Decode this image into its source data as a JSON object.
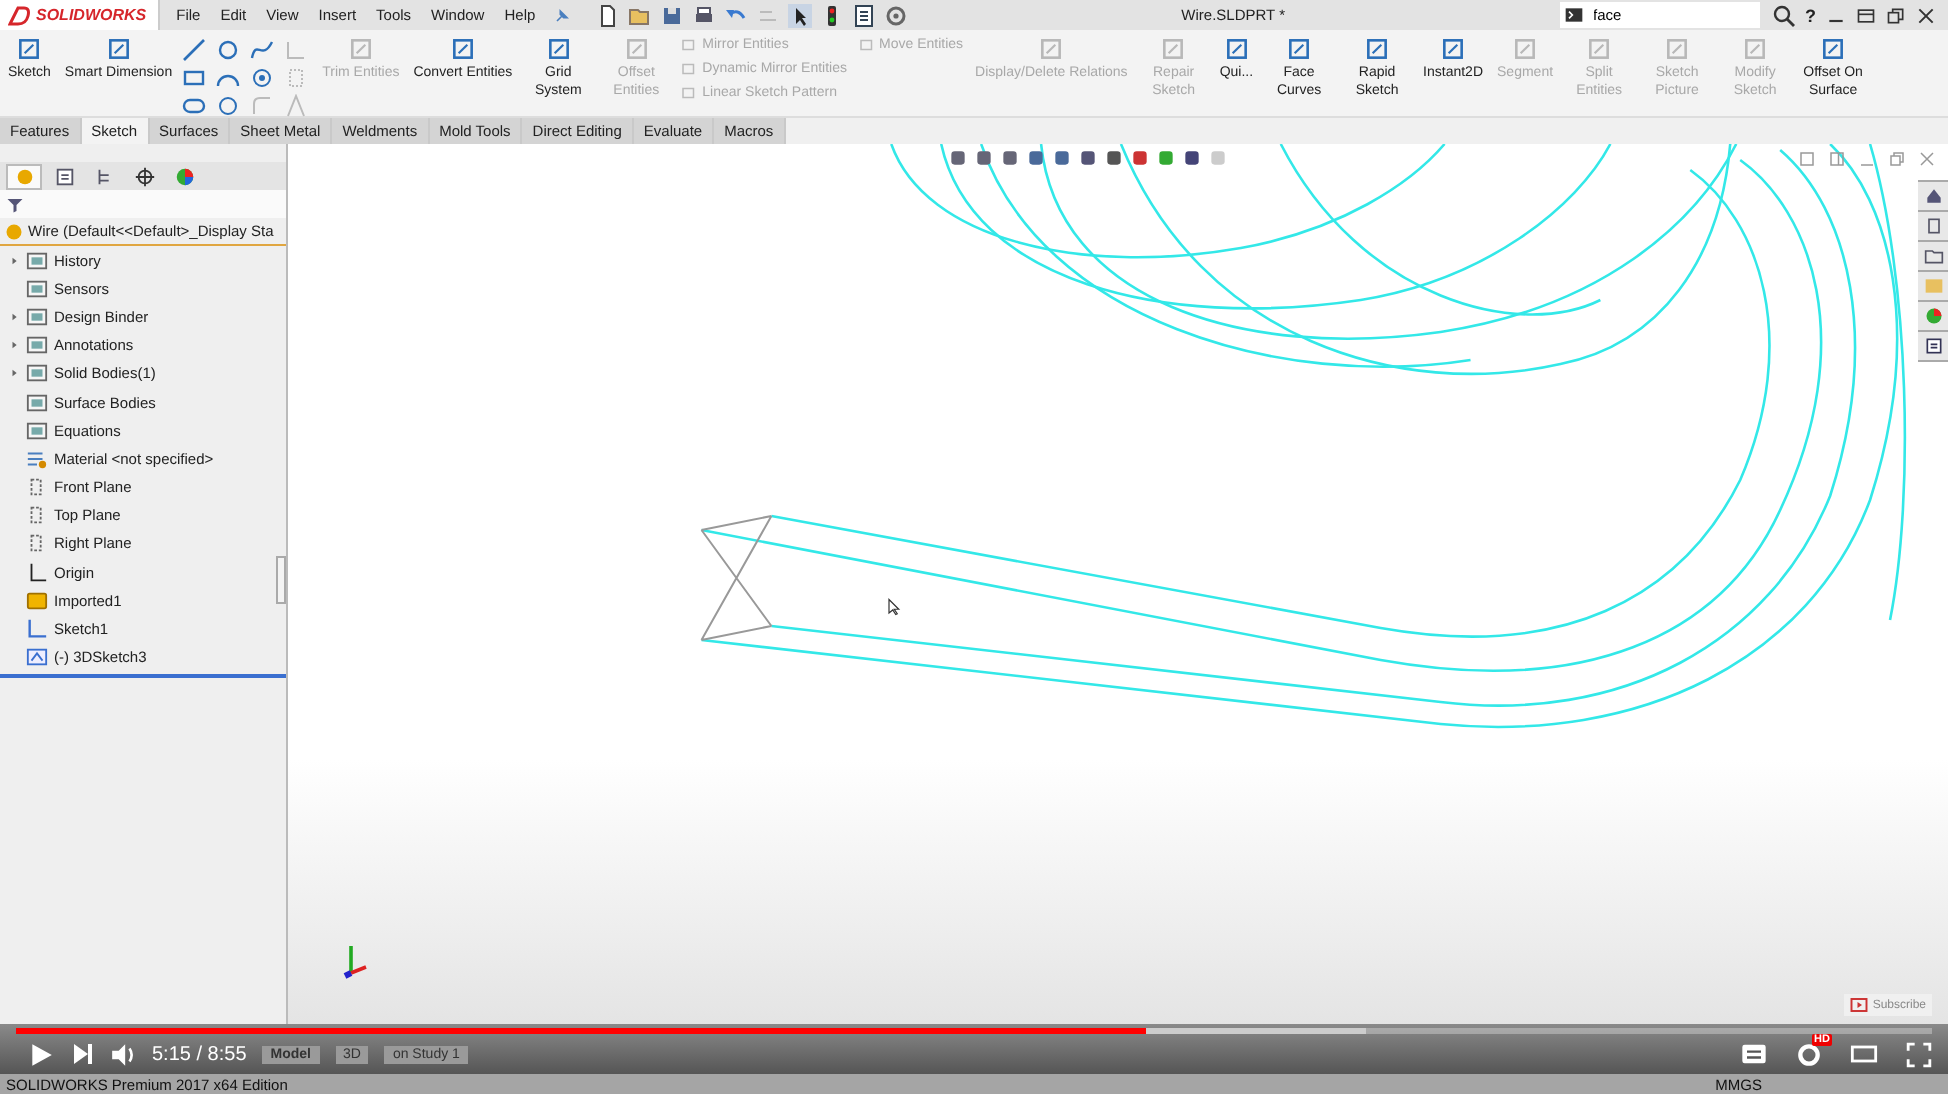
{
  "title_bar": {
    "logo": "SOLIDWORKS",
    "menus": [
      "File",
      "Edit",
      "View",
      "Insert",
      "Tools",
      "Window",
      "Help"
    ],
    "document_title": "Wire.SLDPRT *",
    "search": {
      "value": "face"
    },
    "help": "?"
  },
  "ribbon": [
    {
      "kind": "large",
      "label": "Sketch",
      "disabled": false
    },
    {
      "kind": "large",
      "label": "Smart Dimension",
      "disabled": false
    },
    {
      "kind": "sketch_tools"
    },
    {
      "kind": "large",
      "label": "Trim Entities",
      "disabled": true
    },
    {
      "kind": "large",
      "label": "Convert Entities",
      "disabled": false
    },
    {
      "kind": "tall",
      "label": "Grid System",
      "disabled": false
    },
    {
      "kind": "tall",
      "label": "Offset Entities",
      "disabled": true
    },
    {
      "kind": "stack",
      "items": [
        {
          "label": "Mirror Entities",
          "disabled": true
        },
        {
          "label": "Dynamic Mirror Entities",
          "disabled": true
        },
        {
          "label": "Linear Sketch Pattern",
          "disabled": true
        }
      ]
    },
    {
      "kind": "stack",
      "items": [
        {
          "label": "Move Entities",
          "disabled": true
        }
      ]
    },
    {
      "kind": "large",
      "label": "Display/Delete Relations",
      "disabled": true
    },
    {
      "kind": "tall",
      "label": "Repair Sketch",
      "disabled": true
    },
    {
      "kind": "large",
      "label": "Qui...",
      "disabled": false
    },
    {
      "kind": "tall",
      "label": "Face Curves",
      "disabled": false
    },
    {
      "kind": "tall",
      "label": "Rapid Sketch",
      "disabled": false
    },
    {
      "kind": "large",
      "label": "Instant2D",
      "disabled": false
    },
    {
      "kind": "large",
      "label": "Segment",
      "disabled": true
    },
    {
      "kind": "tall",
      "label": "Split Entities",
      "disabled": true
    },
    {
      "kind": "tall",
      "label": "Sketch Picture",
      "disabled": true
    },
    {
      "kind": "tall",
      "label": "Modify Sketch",
      "disabled": true
    },
    {
      "kind": "tall",
      "label": "Offset On Surface",
      "disabled": false
    }
  ],
  "tabs": [
    {
      "label": "Features",
      "selected": false
    },
    {
      "label": "Sketch",
      "selected": true
    },
    {
      "label": "Surfaces",
      "selected": false
    },
    {
      "label": "Sheet Metal",
      "selected": false
    },
    {
      "label": "Weldments",
      "selected": false
    },
    {
      "label": "Mold Tools",
      "selected": false
    },
    {
      "label": "Direct Editing",
      "selected": false
    },
    {
      "label": "Evaluate",
      "selected": false
    },
    {
      "label": "Macros",
      "selected": false
    }
  ],
  "sidebar": {
    "panel_tabs": [
      {
        "kind": "feature_tree",
        "selected": true
      },
      {
        "kind": "property",
        "selected": false
      },
      {
        "kind": "configuration",
        "selected": false
      },
      {
        "kind": "dimxpert",
        "selected": false
      },
      {
        "kind": "display",
        "selected": false
      }
    ],
    "root": "Wire  (Default<<Default>_Display Sta",
    "items": [
      {
        "label": "History",
        "kind": "folder",
        "expandable": true
      },
      {
        "label": "Sensors",
        "kind": "folder",
        "expandable": false
      },
      {
        "label": "Design Binder",
        "kind": "folder",
        "expandable": true
      },
      {
        "label": "Annotations",
        "kind": "folder",
        "expandable": true
      },
      {
        "label": "Solid Bodies(1)",
        "kind": "folder",
        "expandable": true
      },
      {
        "label": "Surface Bodies",
        "kind": "folder",
        "expandable": false
      },
      {
        "label": "Equations",
        "kind": "folder",
        "expandable": false
      },
      {
        "label": "Material <not specified>",
        "kind": "material",
        "expandable": false
      },
      {
        "label": "Front Plane",
        "kind": "plane",
        "expandable": false
      },
      {
        "label": "Top Plane",
        "kind": "plane",
        "expandable": false
      },
      {
        "label": "Right Plane",
        "kind": "plane",
        "expandable": false
      },
      {
        "label": "Origin",
        "kind": "origin",
        "expandable": false
      },
      {
        "label": "Imported1",
        "kind": "part",
        "expandable": false
      },
      {
        "label": "Sketch1",
        "kind": "sketch",
        "expandable": false
      },
      {
        "label": "(-) 3DSketch3",
        "kind": "sketch3d",
        "expandable": false
      }
    ]
  },
  "canvas": {
    "subscribe": "Subscribe"
  },
  "player": {
    "progress": {
      "level": 0.59,
      "buffer": {
        "level": 0.705
      }
    },
    "time": "5:15 / 8:55",
    "hd_badge": "HD"
  },
  "model_tabs": [
    "Model",
    "3D",
    "on Study 1"
  ],
  "status_bar": {
    "edition": "SOLIDWORKS Premium 2017 x64 Edition",
    "units": "MMGS"
  }
}
